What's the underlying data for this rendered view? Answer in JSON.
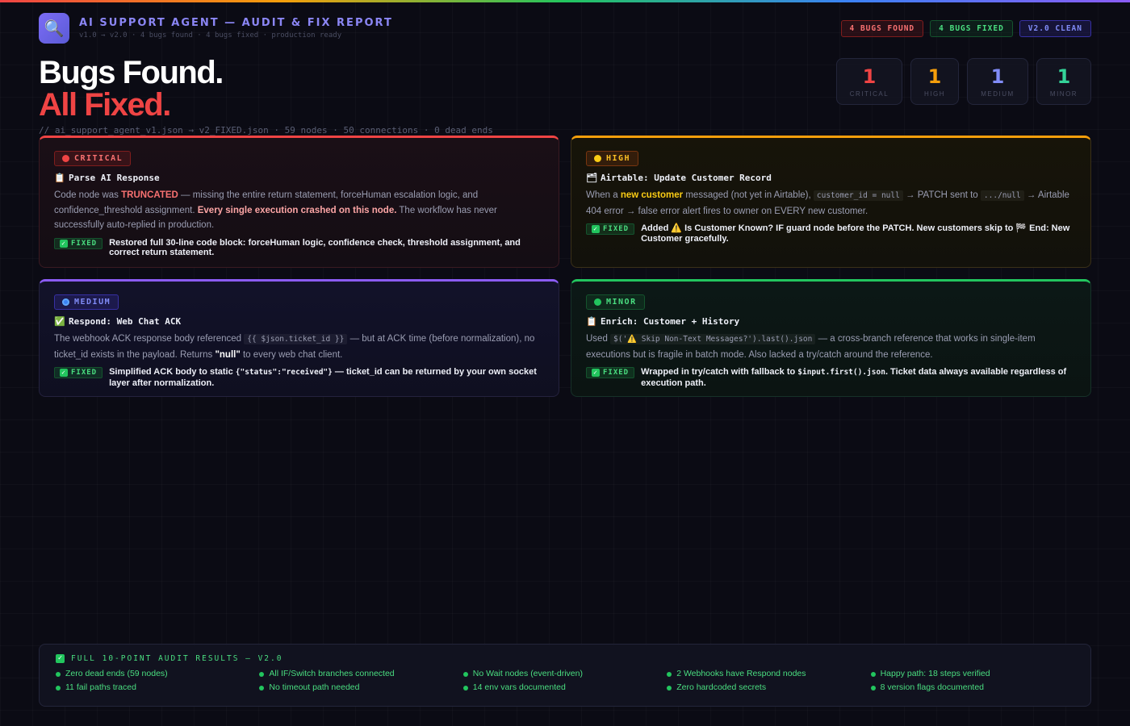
{
  "header": {
    "logo_icon": "magnifier-icon",
    "title": "AI SUPPORT AGENT — AUDIT & FIX REPORT",
    "subtitle": "v1.0 → v2.0 · 4 bugs found · 4 bugs fixed · production ready",
    "badges": [
      "4 BUGS FOUND",
      "4 BUGS FIXED",
      "V2.0 CLEAN"
    ]
  },
  "hero": {
    "line1": "Bugs Found.",
    "line2": "All Fixed.",
    "path": "// ai_support_agent_v1.json → v2_FIXED.json · 59 nodes · 50 connections · 0 dead ends"
  },
  "counts": [
    {
      "value": "1",
      "label": "CRITICAL",
      "color": "#ef4444"
    },
    {
      "value": "1",
      "label": "HIGH",
      "color": "#f59e0b"
    },
    {
      "value": "1",
      "label": "MEDIUM",
      "color": "#818cf8"
    },
    {
      "value": "1",
      "label": "MINOR",
      "color": "#34d399"
    }
  ],
  "bugs": {
    "critical": {
      "severity": "CRITICAL",
      "node_icon": "clipboard-icon",
      "node": "Parse AI Response",
      "desc": {
        "p1": "Code node was ",
        "p2": "TRUNCATED",
        "p3": " — missing the entire return statement, forceHuman escalation logic, and confidence_threshold assignment. ",
        "p4": "Every single execution crashed on this node.",
        "p5": " The workflow has never successfully auto-replied in production."
      },
      "fix_label": "FIXED",
      "fix": "Restored full 30-line code block: forceHuman logic, confidence check, threshold assignment, and correct return statement."
    },
    "high": {
      "severity": "HIGH",
      "node_icon": "folder-icon",
      "node": "Airtable: Update Customer Record",
      "desc": {
        "p1": "When a ",
        "p2": "new customer",
        "p3": " messaged (not yet in Airtable), ",
        "c1": "customer_id = null",
        "p4": " → PATCH sent to ",
        "c2": ".../null",
        "p5": " → Airtable 404 error → false error alert fires to owner on EVERY new customer."
      },
      "fix_label": "FIXED",
      "fix": "Added ⚠️ Is Customer Known? IF guard node before the PATCH. New customers skip to 🏁 End: New Customer gracefully."
    },
    "medium": {
      "severity": "MEDIUM",
      "node_icon": "check-icon",
      "node": "Respond: Web Chat ACK",
      "desc": {
        "p1": "The webhook ACK response body referenced ",
        "c1": "{{ $json.ticket_id }}",
        "p2": " — but at ACK time (before normalization), no ticket_id exists in the payload. Returns ",
        "p3": "\"null\"",
        "p4": " to every web chat client."
      },
      "fix_label": "FIXED",
      "fix_p1": "Simplified ACK body to static ",
      "fix_c1": "{\"status\":\"received\"}",
      "fix_p2": " — ticket_id can be returned by your own socket layer after normalization."
    },
    "minor": {
      "severity": "MINOR",
      "node_icon": "clipboard-icon",
      "node": "Enrich: Customer + History",
      "desc": {
        "p1": "Used ",
        "c1": "$('⚠️ Skip Non-Text Messages?').last().json",
        "p2": " — a cross-branch reference that works in single-item executions but is fragile in batch mode. Also lacked a try/catch around the reference."
      },
      "fix_label": "FIXED",
      "fix_p1": "Wrapped in try/catch with fallback to ",
      "fix_c1": "$input.first().json",
      "fix_p2": ". Ticket data always available regardless of execution path."
    }
  },
  "audit": {
    "title": "FULL 10-POINT AUDIT RESULTS — V2.0",
    "items": [
      "Zero dead ends (59 nodes)",
      "All IF/Switch branches connected",
      "No Wait nodes (event-driven)",
      "2 Webhooks have Respond nodes",
      "Happy path: 18 steps verified",
      "11 fail paths traced",
      "No timeout path needed",
      "14 env vars documented",
      "Zero hardcoded secrets",
      "8 version flags documented"
    ]
  }
}
